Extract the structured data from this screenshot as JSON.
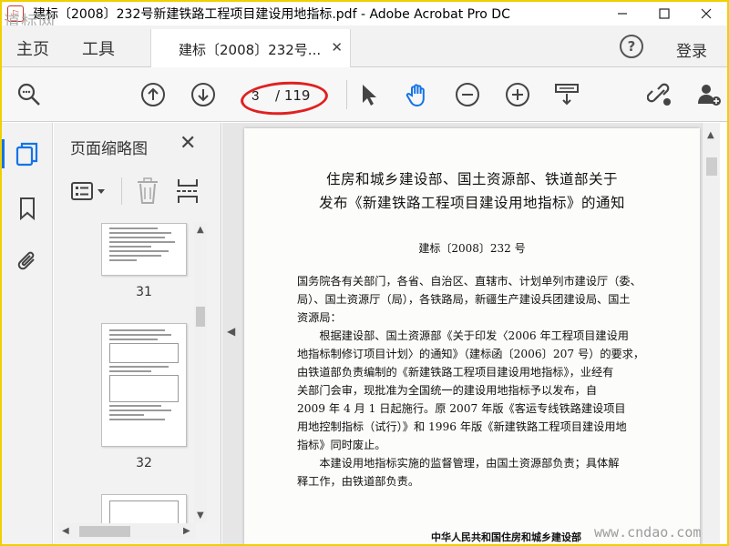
{
  "window": {
    "title": "建标〔2008〕232号新建铁路工程项目建设用地指标.pdf - Adobe Acrobat Pro DC",
    "watermark_top": "道标网"
  },
  "menu": {
    "home": "主页",
    "tools": "工具",
    "doc_tab": "建标〔2008〕232号...",
    "login": "登录"
  },
  "toolbar": {
    "current_page": "3",
    "total_pages": "/ 119"
  },
  "thumbnails": {
    "title": "页面缩略图",
    "pages": [
      "31",
      "32"
    ]
  },
  "document": {
    "title_line1": "住房和城乡建设部、国土资源部、铁道部关于",
    "title_line2": "发布《新建铁路工程项目建设用地指标》的通知",
    "doc_number": "建标〔2008〕232 号",
    "paragraph1": [
      "国务院各有关部门，各省、自治区、直辖市、计划单列市建设厅（委、",
      "局）、国土资源厅（局），各铁路局，新疆生产建设兵团建设局、国土",
      "资源局："
    ],
    "paragraph2": [
      "　　根据建设部、国土资源部《关于印发〈2006 年工程项目建设用",
      "地指标制修订项目计划〉的通知》（建标函〔2006〕207 号）的要求，",
      "由铁道部负责编制的《新建铁路工程项目建设用地指标》，业经有",
      "关部门会审，现批准为全国统一的建设用地指标予以发布，自",
      "2009 年 4 月 1 日起施行。原 2007 年版《客运专线铁路建设项目",
      "用地控制指标（试行）》和 1996 年版《新建铁路工程项目建设用地",
      "指标》同时废止。"
    ],
    "paragraph3": [
      "　　本建设用地指标实施的监督管理，由国土资源部负责；具体解",
      "释工作，由铁道部负责。"
    ],
    "footer": "中华人民共和国住房和城乡建设部"
  },
  "watermark_bottom": "www.cndao.com",
  "colors": {
    "accent": "#1473e6",
    "highlight": "#e02020",
    "frame": "#f0d000"
  }
}
